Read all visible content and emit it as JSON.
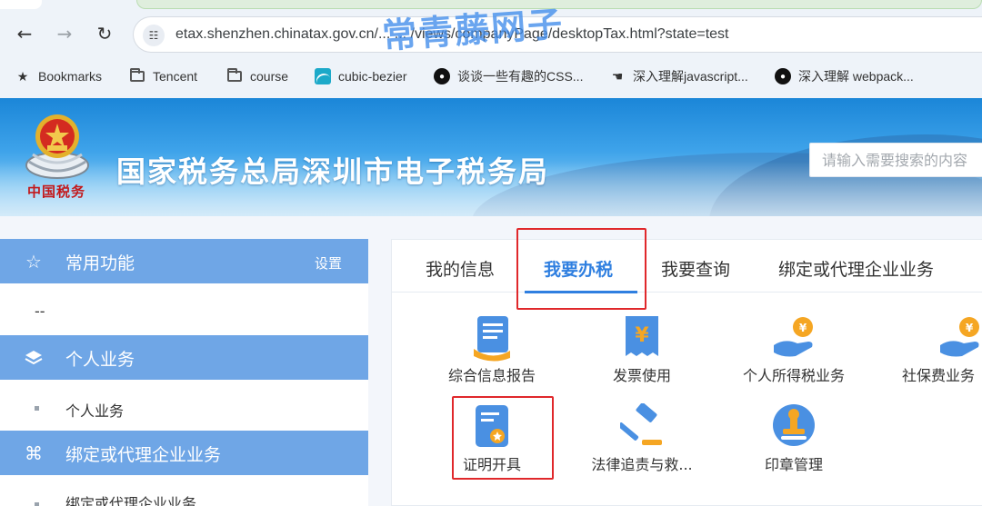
{
  "browser": {
    "url": "etax.shenzhen.chinatax.gov.cn/... ... /views/companyPage/desktopTax.html?state=test",
    "watermark": "常青藤网子",
    "bookmarks": [
      {
        "label": "Bookmarks",
        "icon": "star-icon"
      },
      {
        "label": "Tencent",
        "icon": "folder-icon"
      },
      {
        "label": "course",
        "icon": "folder-icon"
      },
      {
        "label": "cubic-bezier",
        "icon": "cubic-bezier-icon"
      },
      {
        "label": "谈谈一些有趣的CSS...",
        "icon": "github-icon"
      },
      {
        "label": "深入理解javascript...",
        "icon": "bookmark-site-icon"
      },
      {
        "label": "深入理解 webpack...",
        "icon": "github-icon"
      }
    ]
  },
  "header": {
    "emblem_text": "中国税务",
    "title": "国家税务总局深圳市电子税务局",
    "search_placeholder": "请输入需要搜索的内容"
  },
  "sidebar": {
    "sections": [
      {
        "title": "常用功能",
        "icon": "star-icon",
        "setting": "设置",
        "items": [
          "--"
        ]
      },
      {
        "title": "个人业务",
        "icon": "layers-icon",
        "items": [
          "个人业务"
        ]
      },
      {
        "title": "绑定或代理企业业务",
        "icon": "command-icon",
        "items": [
          "绑定或代理企业业务"
        ]
      }
    ]
  },
  "main": {
    "tabs": [
      "我的信息",
      "我要办税",
      "我要查询",
      "绑定或代理企业业务"
    ],
    "active_tab": "我要办税",
    "services": [
      {
        "label": "综合信息报告",
        "icon": "report-icon"
      },
      {
        "label": "发票使用",
        "icon": "invoice-icon"
      },
      {
        "label": "个人所得税业务",
        "icon": "hand-coin-icon"
      },
      {
        "label": "社保费业务",
        "icon": "hand-coin-icon"
      },
      {
        "label": "证明开具",
        "icon": "certificate-icon"
      },
      {
        "label": "法律追责与救...",
        "icon": "gavel-icon"
      },
      {
        "label": "印章管理",
        "icon": "seal-icon"
      }
    ]
  },
  "colors": {
    "accent": "#2f7fe0",
    "sidebar_header": "#6fa6e6",
    "highlight_box": "#e0282b",
    "icon_orange": "#f5a623"
  }
}
